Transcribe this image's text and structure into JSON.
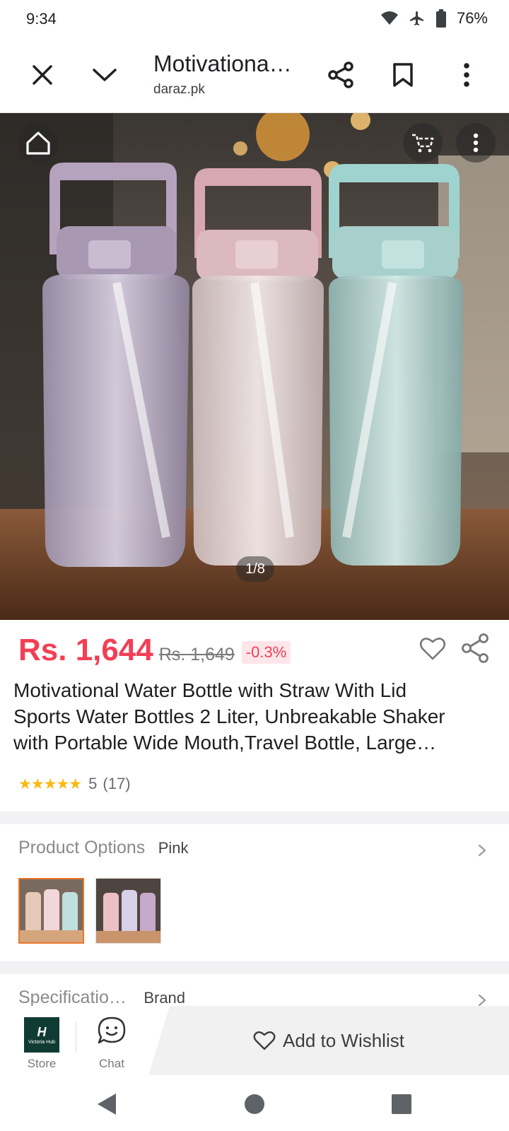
{
  "status_bar": {
    "time": "9:34",
    "battery": "76%"
  },
  "toolbar": {
    "title": "Motivationa…",
    "domain": "daraz.pk"
  },
  "hero": {
    "counter": "1/8"
  },
  "product": {
    "price": "Rs. 1,644",
    "old_price": "Rs. 1,649",
    "discount": "-0.3%",
    "title_lines": [
      "Motivational Water Bottle with Straw With Lid",
      "Sports Water Bottles 2 Liter, Unbreakable Shaker",
      "with Portable Wide Mouth,Travel Bottle, Large…"
    ],
    "stars": "★★★★★",
    "rating": "5",
    "rating_count": "(17)"
  },
  "options": {
    "label": "Product Options",
    "value": "Pink"
  },
  "specifications": {
    "label": "Specificatio…",
    "value": "Brand"
  },
  "action_bar": {
    "store_label": "Store",
    "store_logo_text": "Victoria Hub",
    "chat_label": "Chat",
    "wishlist_label": "Add to Wishlist"
  },
  "colors": {
    "price": "#f23f55",
    "star": "#fbb911",
    "accent_border": "#e9762b"
  },
  "icons": [
    "wifi-icon",
    "airplane-icon",
    "battery-icon",
    "close-icon",
    "chevron-down-icon",
    "share-icon",
    "bookmark-icon",
    "more-vert-icon",
    "home-icon",
    "cart-icon",
    "heart-icon",
    "chat-icon",
    "back-icon",
    "home-nav-icon",
    "recents-icon"
  ]
}
